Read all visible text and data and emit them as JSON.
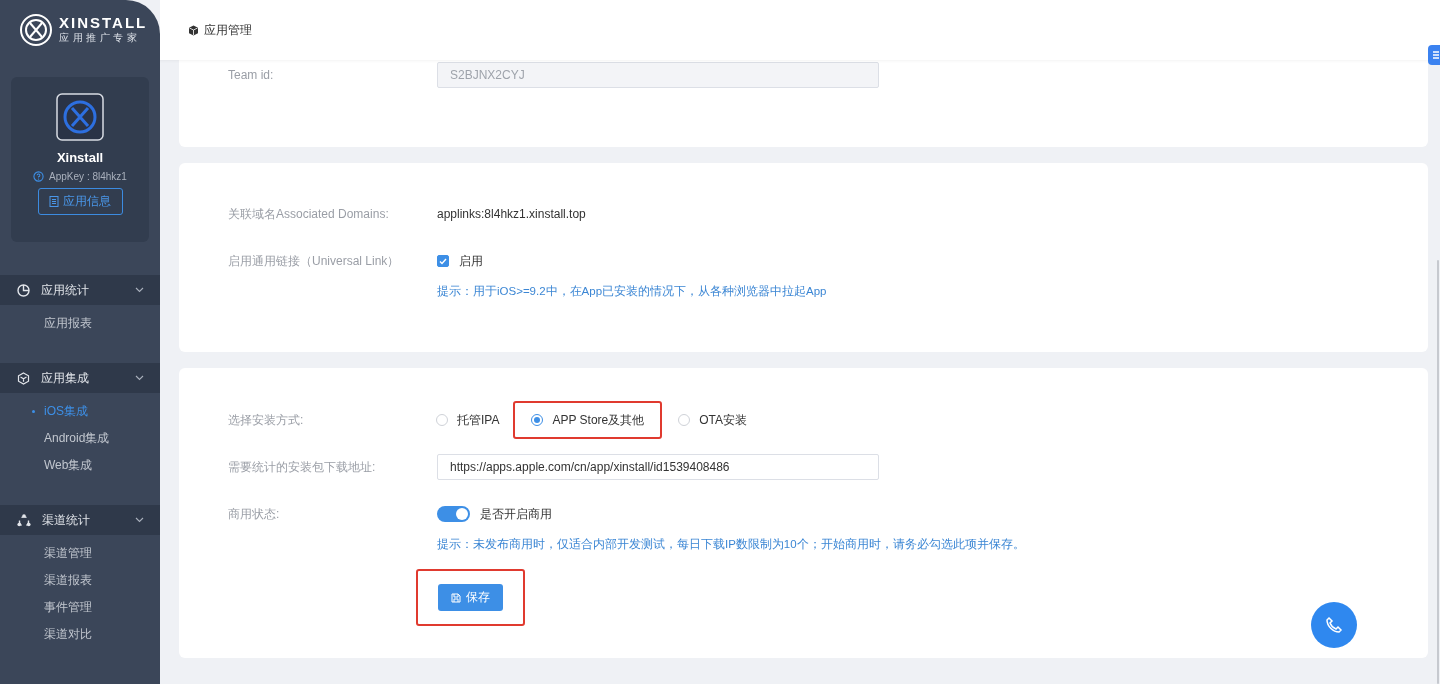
{
  "brand": {
    "name": "XINSTALL",
    "tagline": "应用推广专家"
  },
  "app": {
    "name": "Xinstall",
    "appkey": "AppKey : 8l4hkz1",
    "info_button": "应用信息"
  },
  "nav": [
    {
      "label": "应用统计",
      "expanded": true,
      "children": [
        {
          "label": "应用报表",
          "selected": false
        }
      ]
    },
    {
      "label": "应用集成",
      "expanded": true,
      "children": [
        {
          "label": "iOS集成",
          "selected": true
        },
        {
          "label": "Android集成",
          "selected": false
        },
        {
          "label": "Web集成",
          "selected": false
        }
      ]
    },
    {
      "label": "渠道统计",
      "expanded": true,
      "children": [
        {
          "label": "渠道管理",
          "selected": false
        },
        {
          "label": "渠道报表",
          "selected": false
        },
        {
          "label": "事件管理",
          "selected": false
        },
        {
          "label": "渠道对比",
          "selected": false
        }
      ]
    }
  ],
  "header": {
    "title": "应用管理"
  },
  "cards": [
    {
      "rows": [
        {
          "kind": "input",
          "label": "Team id:",
          "value": "S2BJNX2CYJ",
          "disabled": true
        }
      ]
    },
    {
      "rows": [
        {
          "kind": "text",
          "label": "关联域名Associated Domains:",
          "value": "applinks:8l4hkz1.xinstall.top"
        },
        {
          "kind": "checkbox",
          "label": "启用通用链接（Universal Link）",
          "option": "启用",
          "checked": true,
          "hint": "提示：用于iOS>=9.2中，在App已安装的情况下，从各种浏览器中拉起App"
        }
      ]
    },
    {
      "rows": [
        {
          "kind": "radio",
          "label": "选择安装方式:",
          "options": [
            {
              "label": "托管IPA",
              "selected": false,
              "highlighted": false
            },
            {
              "label": "APP Store及其他",
              "selected": true,
              "highlighted": true
            },
            {
              "label": "OTA安装",
              "selected": false,
              "highlighted": false
            }
          ]
        },
        {
          "kind": "input",
          "label": "需要统计的安装包下载地址:",
          "value": "https://apps.apple.com/cn/app/xinstall/id1539408486",
          "disabled": false
        },
        {
          "kind": "switch",
          "label": "商用状态:",
          "option": "是否开启商用",
          "on": true,
          "hint": "提示：未发布商用时，仅适合内部开发测试，每日下载IP数限制为10个；开始商用时，请务必勾选此项并保存。"
        },
        {
          "kind": "button",
          "label": "保存",
          "highlighted": true
        }
      ]
    }
  ]
}
